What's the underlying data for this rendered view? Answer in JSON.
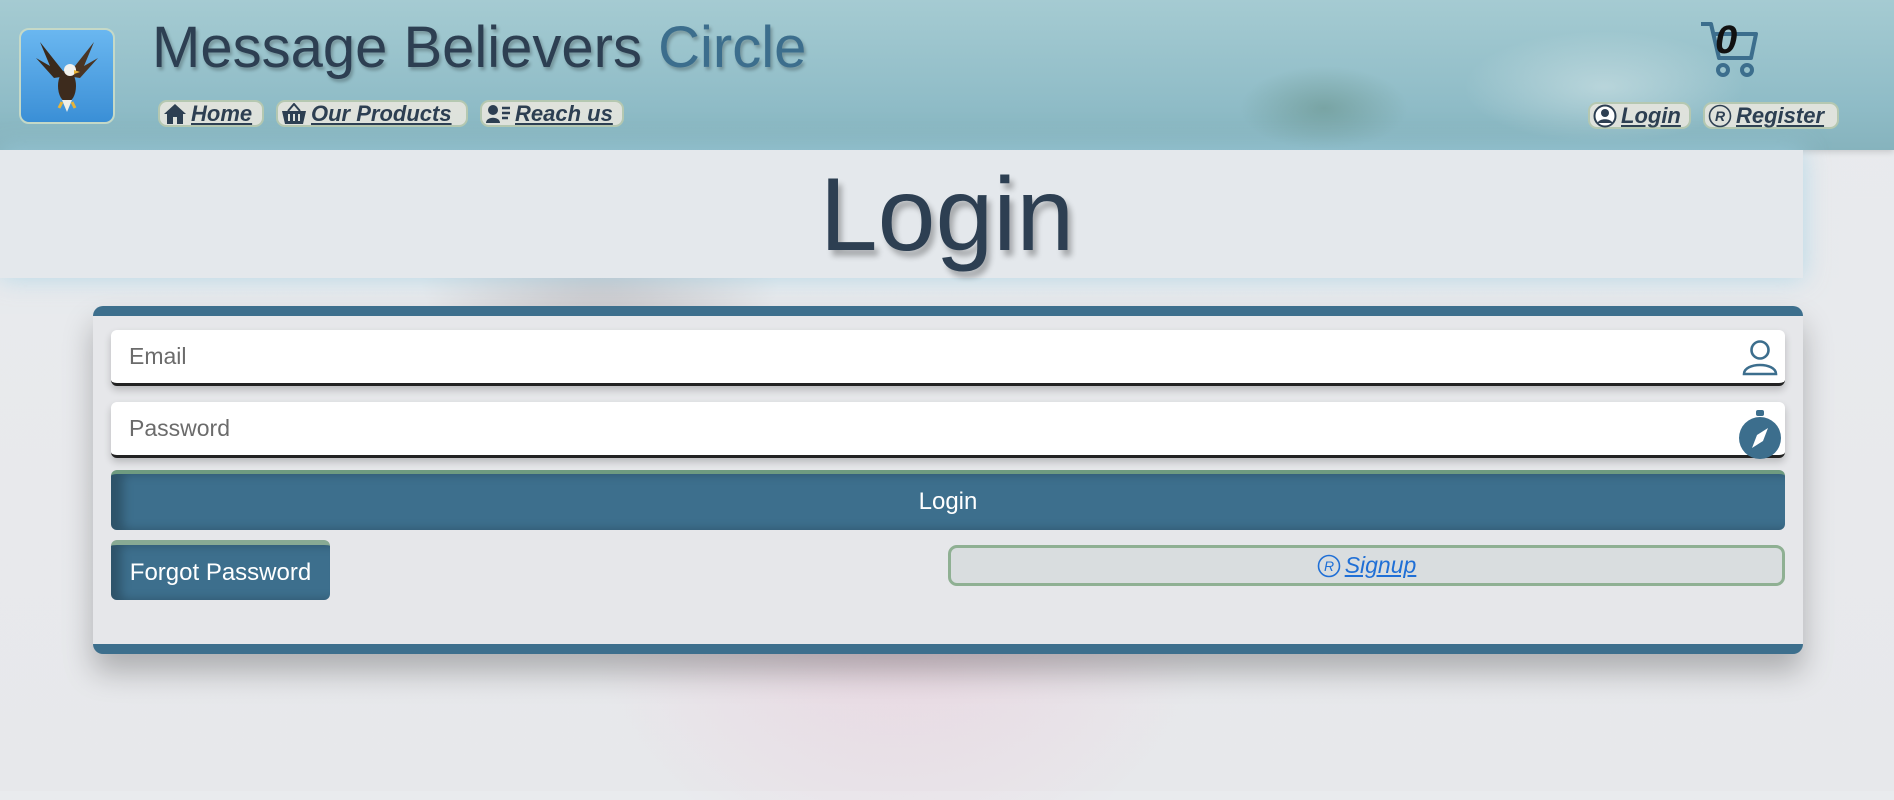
{
  "header": {
    "title_main": "Message Believers ",
    "title_accent": "Circle",
    "cart_count": "0",
    "nav": [
      {
        "label": "Home",
        "icon": "home-icon"
      },
      {
        "label": "Our Products",
        "icon": "basket-icon"
      },
      {
        "label": "Reach us",
        "icon": "contact-card-icon"
      }
    ],
    "account": [
      {
        "label": "Login",
        "icon": "user-circle-icon"
      },
      {
        "label": "Register",
        "icon": "registered-icon"
      }
    ]
  },
  "page": {
    "heading": "Login"
  },
  "form": {
    "email_placeholder": "Email",
    "password_placeholder": "Password",
    "login_label": "Login",
    "forgot_label": "Forgot Password",
    "signup_label": "Signup"
  },
  "colors": {
    "primary": "#3d6f8d",
    "title": "#2d3f52",
    "link": "#1f6fd6"
  }
}
